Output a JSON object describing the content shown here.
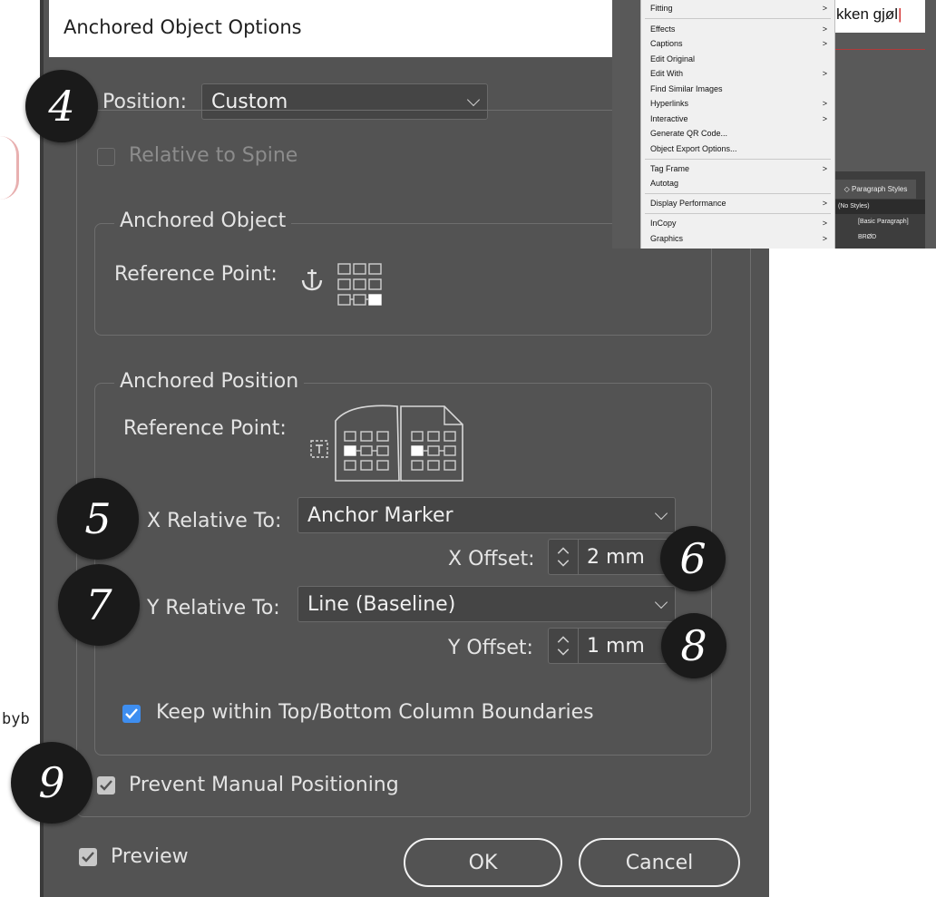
{
  "dialog": {
    "title": "Anchored Object Options",
    "position": {
      "label": "Position:",
      "value": "Custom"
    },
    "relative_to_spine": {
      "label": "Relative to Spine",
      "checked": false,
      "enabled": false
    },
    "anchored_object": {
      "group_title": "Anchored Object",
      "reference_point_label": "Reference Point:",
      "icon": "anchor-icon"
    },
    "anchored_position": {
      "group_title": "Anchored Position",
      "reference_point_label": "Reference Point:",
      "x_relative_label": "X Relative To:",
      "x_relative_value": "Anchor Marker",
      "x_offset_label": "X Offset:",
      "x_offset_value": "2 mm",
      "y_relative_label": "Y Relative To:",
      "y_relative_value": "Line (Baseline)",
      "y_offset_label": "Y Offset:",
      "y_offset_value": "1 mm",
      "keep_within": {
        "label": "Keep within Top/Bottom Column Boundaries",
        "checked": true
      }
    },
    "prevent_manual": {
      "label": "Prevent Manual Positioning",
      "checked": true
    },
    "preview": {
      "label": "Preview",
      "checked": true
    },
    "ok_label": "OK",
    "cancel_label": "Cancel"
  },
  "badges": [
    "4",
    "5",
    "6",
    "7",
    "8",
    "9"
  ],
  "context_menu": {
    "items": [
      {
        "label": "Fitting",
        "submenu": true
      },
      {
        "label": "Effects",
        "submenu": true
      },
      {
        "label": "Captions",
        "submenu": true
      },
      {
        "label": "Edit Original",
        "submenu": false
      },
      {
        "label": "Edit With",
        "submenu": true
      },
      {
        "label": "Find Similar Images",
        "submenu": false
      },
      {
        "label": "Hyperlinks",
        "submenu": true
      },
      {
        "label": "Interactive",
        "submenu": true
      },
      {
        "label": "Generate QR Code...",
        "submenu": false
      },
      {
        "label": "Object Export Options...",
        "submenu": false
      },
      {
        "label": "Tag Frame",
        "submenu": true
      },
      {
        "label": "Autotag",
        "submenu": false
      },
      {
        "label": "Display Performance",
        "submenu": true
      },
      {
        "label": "InCopy",
        "submenu": true
      },
      {
        "label": "Graphics",
        "submenu": true
      }
    ],
    "submenu_arrow": ">"
  },
  "document": {
    "text": "kken gjøl",
    "paragraph_styles": {
      "tab": "◇ Paragraph Styles",
      "items": [
        "(No Styles)",
        "[Basic Paragraph]",
        "BRØD"
      ]
    },
    "side_text": "byb"
  },
  "colors": {
    "dialog_bg": "#535353",
    "field_bg": "#454545",
    "checkbox_accent": "#3e8ef0",
    "badge_bg": "#1a1a1a"
  }
}
